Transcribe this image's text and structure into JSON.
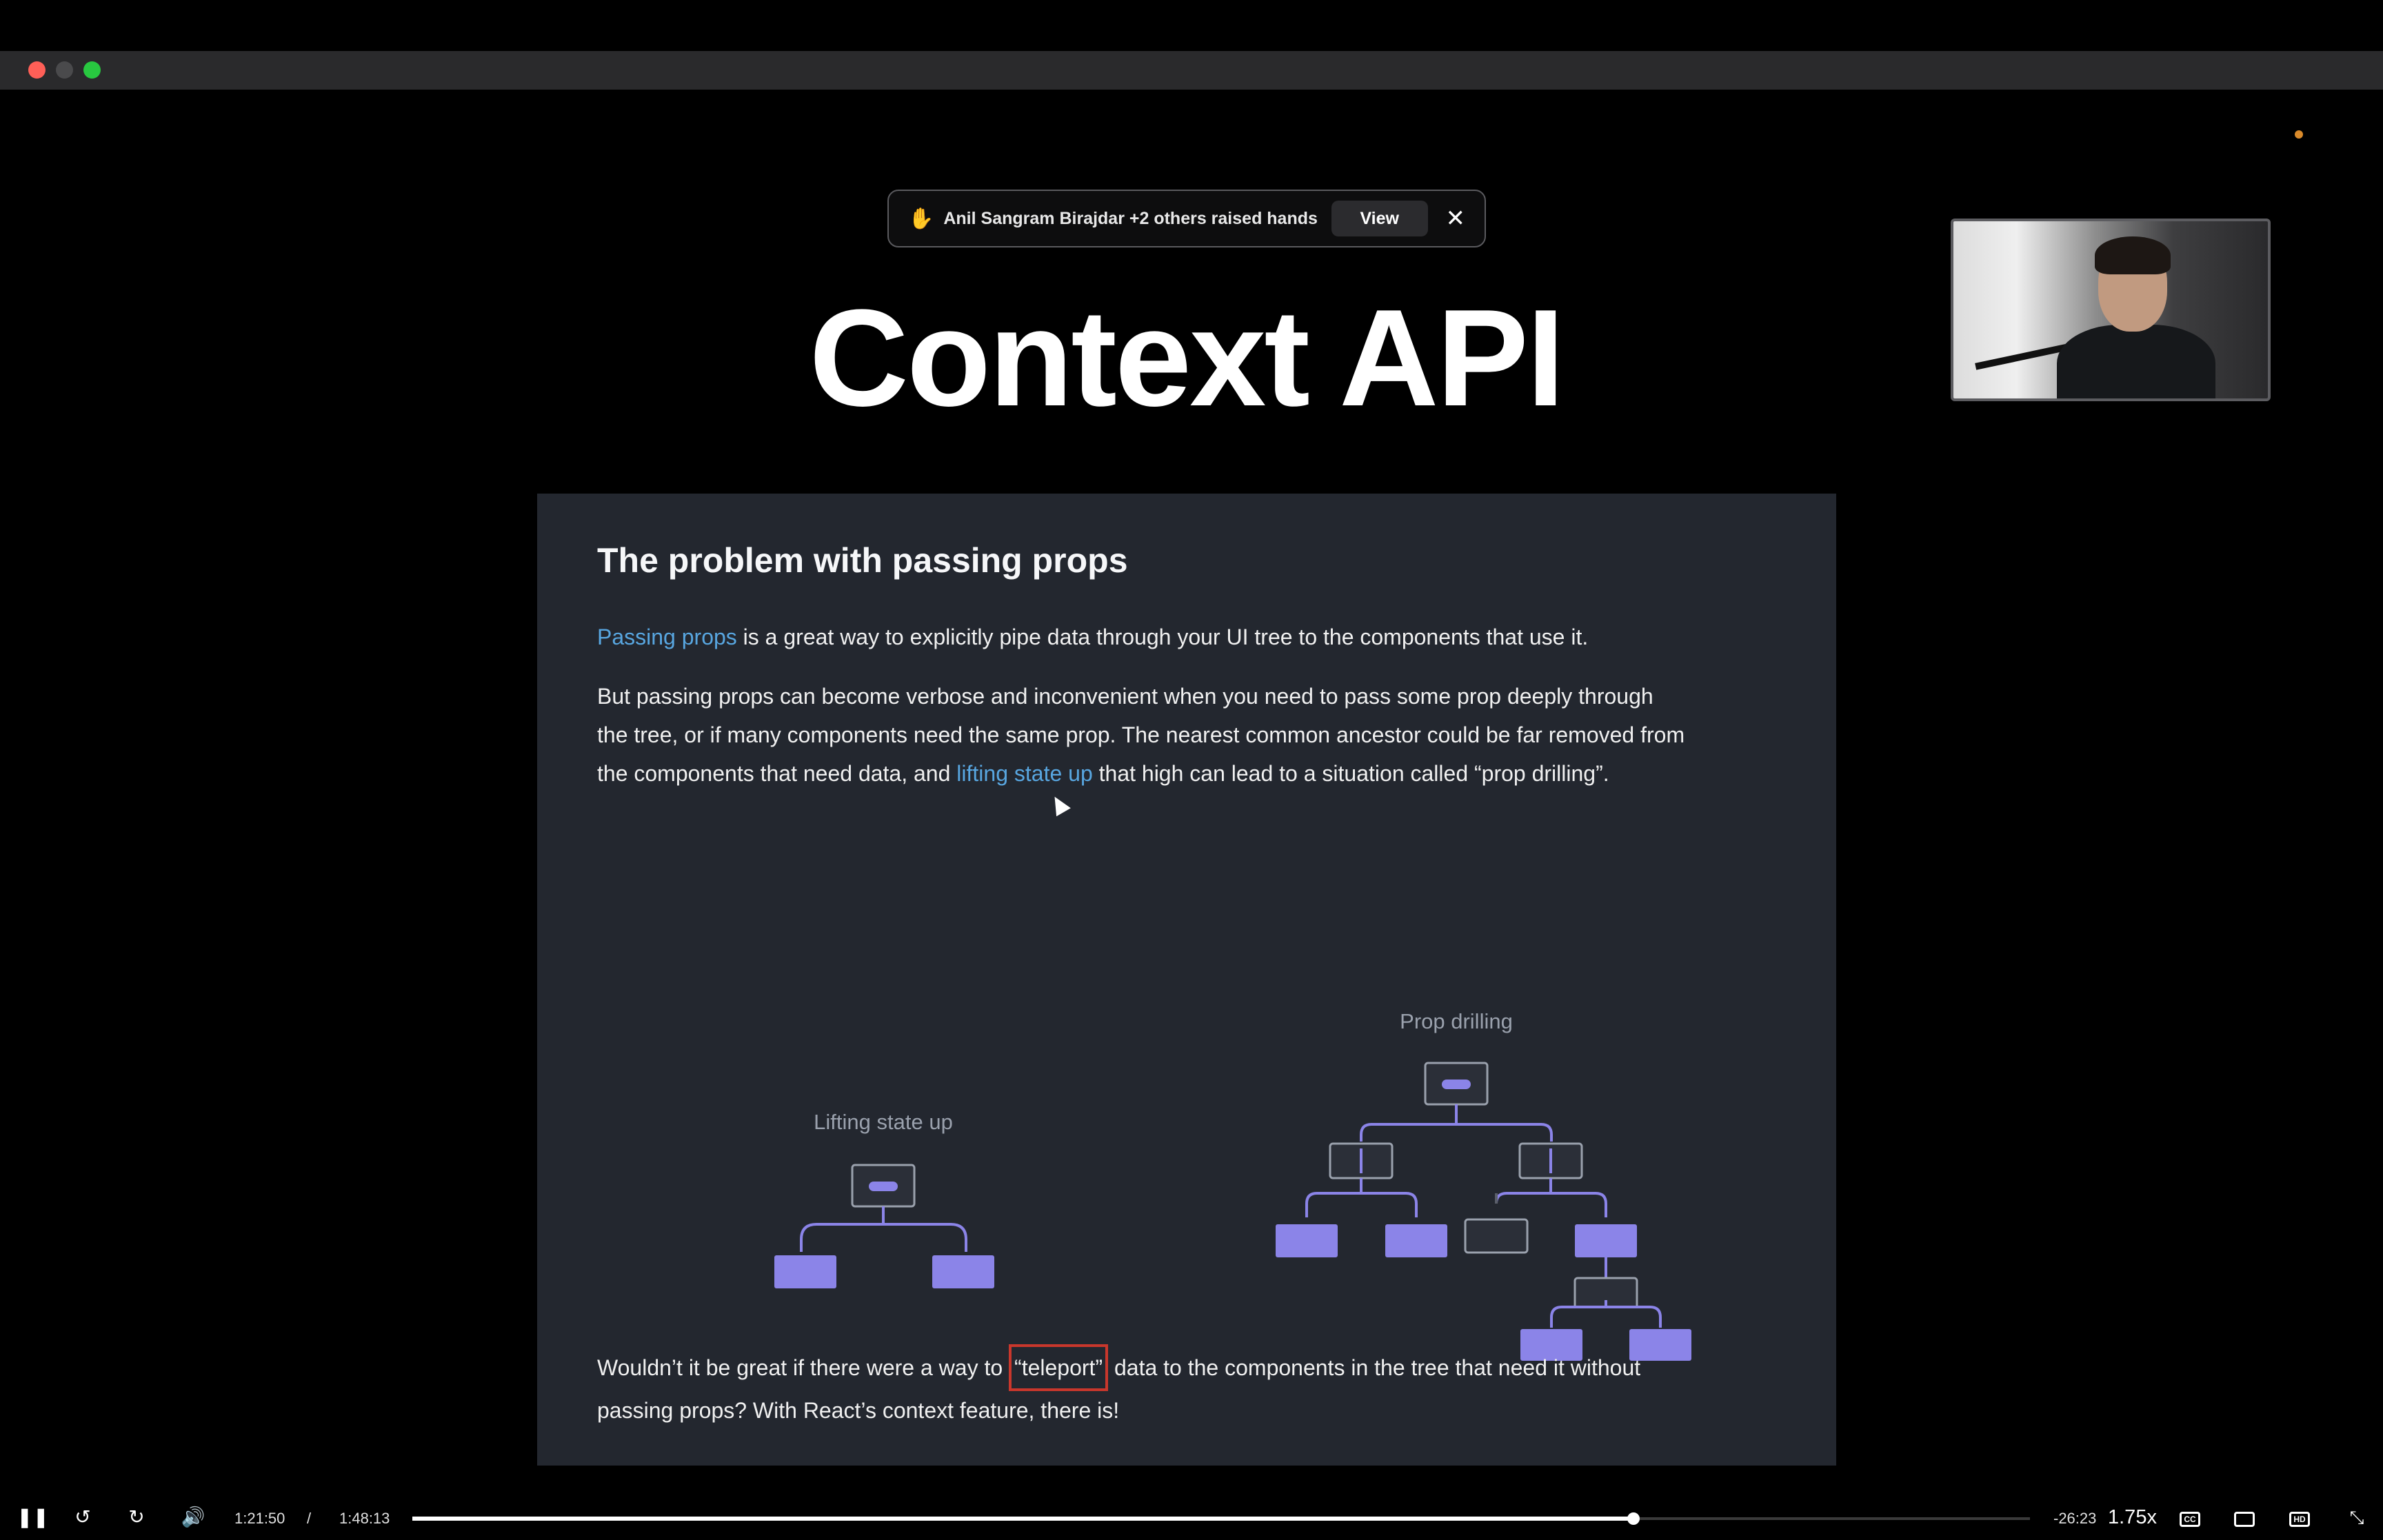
{
  "window": {
    "traffic_lights": [
      "close",
      "minimize",
      "maximize"
    ]
  },
  "notification": {
    "icon": "raised-hand-icon",
    "text": "Anil Sangram Birajdar +2 others raised hands",
    "view_label": "View",
    "close_symbol": "✕"
  },
  "slide": {
    "heading": "Context API"
  },
  "card": {
    "title": "The problem with passing props",
    "p1_link": "Passing props",
    "p1_rest": " is a great way to explicitly pipe data through your UI tree to the components that use it.",
    "p2_line1": "But passing props can become verbose and inconvenient when you need to pass some prop deeply through",
    "p2_line2": "the tree, or if many components need the same prop. The nearest common ancestor could be far removed from",
    "p2_line3_a": "the components that need data, and ",
    "p2_link": "lifting state up",
    "p2_line3_b": " that high can lead to a situation called “prop drilling”.",
    "diagram_left_label": "Lifting state up",
    "diagram_right_label": "Prop drilling",
    "p3_a": "Wouldn’t it be great if there were a way to ",
    "p3_highlight": "“teleport”",
    "p3_b": " data to the components in the tree that need it without",
    "p3_line2": "passing props? With React’s context feature, there is!"
  },
  "player": {
    "current_time": "1:21:50",
    "separator": "/",
    "duration": "1:48:13",
    "remaining": "-26:23",
    "speed": "1.75x",
    "progress_fraction": 0.755,
    "cc_label": "CC",
    "hd_label": "HD"
  },
  "colors": {
    "card_bg": "#23272f",
    "link": "#58a6e0",
    "tree_accent": "#8b84e8",
    "highlight_border": "#c9372c",
    "record_dot": "#d98a2a"
  }
}
